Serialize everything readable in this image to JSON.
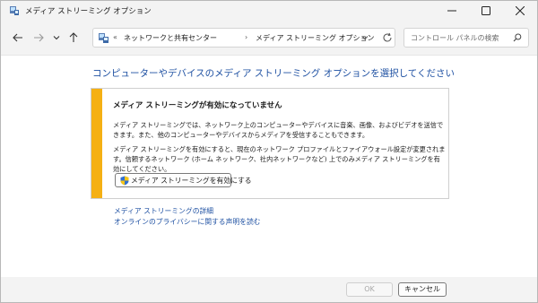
{
  "window": {
    "title": "メディア ストリーミング オプション",
    "controls": {
      "minimize": "minimize-icon",
      "maximize": "maximize-icon",
      "close": "close-icon"
    }
  },
  "nav": {
    "back": "arrow-left-icon",
    "forward": "arrow-right-icon",
    "recent": "chevron-down-icon",
    "up": "arrow-up-icon",
    "address": {
      "prefix": "«",
      "crumbs": [
        "ネットワークと共有センター",
        "メディア ストリーミング オプション"
      ],
      "separator": "›"
    },
    "search_placeholder": "コントロール パネルの検索"
  },
  "content": {
    "heading": "コンピューターやデバイスのメディア ストリーミング オプションを選択してください",
    "panel": {
      "title": "メディア ストリーミングが有効になっていません",
      "paragraph1": "メディア ストリーミングでは、ネットワーク上のコンピューターやデバイスに音楽、画像、およびビデオを送信できます。また、他のコンピューターやデバイスからメディアを受信することもできます。",
      "paragraph2": "メディア ストリーミングを有効にすると、現在のネットワーク プロファイルとファイアウォール設定が変更されます。信頼するネットワーク (ホーム ネットワーク、社内ネットワークなど) 上でのみメディア ストリーミングを有効にしてください。",
      "enable_button": "メディア ストリーミングを有効にする",
      "accent_color": "#f5b014"
    },
    "links": [
      "メディア ストリーミングの詳細",
      "オンラインのプライバシーに関する声明を読む"
    ],
    "link_color": "#1e50a2"
  },
  "footer": {
    "ok": "OK",
    "cancel": "キャンセル"
  }
}
